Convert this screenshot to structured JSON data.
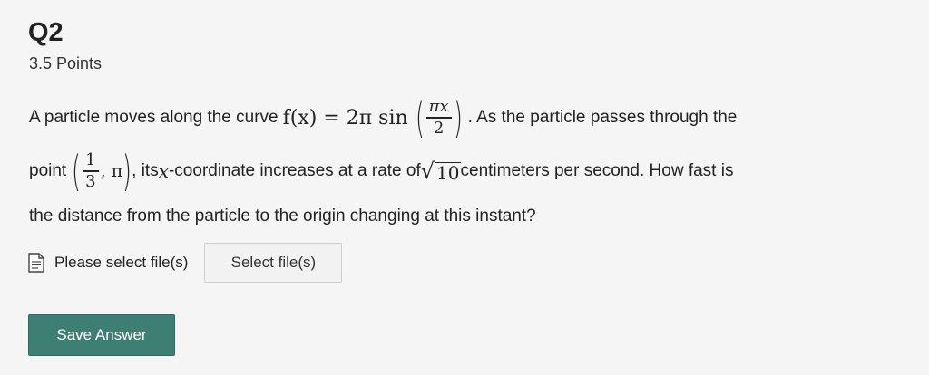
{
  "question": {
    "title": "Q2",
    "points": "3.5 Points"
  },
  "problem": {
    "line1_start": "A particle moves along the curve ",
    "fx": "f(x) = 2π sin",
    "frac1_num": "πx",
    "frac1_den": "2",
    "line1_end": ". As  the particle passes through the",
    "line2_start": "point ",
    "frac2_num": "1",
    "frac2_den": "3",
    "point_y": ", π",
    "line2_mid1": ", its ",
    "coord_var": "x",
    "line2_mid2": "-coordinate increases at a rate of ",
    "sqrt_value": "10",
    "line2_end": " centimeters per second. How fast is",
    "line3": "the distance from the particle to the origin changing at this instant?"
  },
  "upload": {
    "icon": "document-icon",
    "label": "Please select file(s)",
    "button_label": "Select file(s)"
  },
  "actions": {
    "save_label": "Save Answer"
  },
  "colors": {
    "background": "#f5f5f5",
    "save_button": "#3d7f72",
    "text": "#222222"
  }
}
